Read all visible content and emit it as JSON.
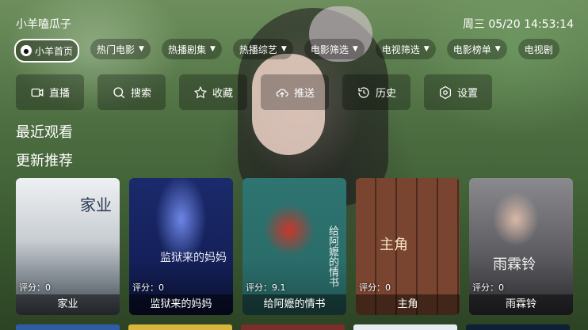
{
  "app": {
    "title": "小羊嗑瓜子"
  },
  "clock": {
    "text": "周三 05/20 14:53:14"
  },
  "menu": [
    {
      "label": "小羊首页",
      "active": true,
      "dropdown": false,
      "logo": "sheep-logo"
    },
    {
      "label": "热门电影",
      "dropdown": true
    },
    {
      "label": "热播剧集",
      "dropdown": true
    },
    {
      "label": "热播综艺",
      "dropdown": true
    },
    {
      "label": "电影筛选",
      "dropdown": true
    },
    {
      "label": "电视筛选",
      "dropdown": true
    },
    {
      "label": "电影榜单",
      "dropdown": true
    },
    {
      "label": "电视剧",
      "dropdown": false
    }
  ],
  "actions": [
    {
      "label": "直播",
      "icon": "live-camera-icon"
    },
    {
      "label": "搜索",
      "icon": "search-icon"
    },
    {
      "label": "收藏",
      "icon": "star-icon"
    },
    {
      "label": "推送",
      "icon": "cloud-upload-icon"
    },
    {
      "label": "历史",
      "icon": "history-icon"
    },
    {
      "label": "设置",
      "icon": "settings-icon"
    }
  ],
  "sections": {
    "recent": "最近观看",
    "updates": "更新推荐"
  },
  "cards": [
    {
      "title": "家业",
      "score": "评分：0",
      "poster_text": "家业",
      "colors": [
        "#e9ecef",
        "#8a8f95"
      ]
    },
    {
      "title": "监狱来的妈妈",
      "score": "评分：0",
      "poster_text": "监狱来的妈妈",
      "colors": [
        "#1b2a6b",
        "#0a0f2a"
      ]
    },
    {
      "title": "给阿嬷的情书",
      "score": "评分：9.1",
      "poster_text": "给阿嬷的情书",
      "colors": [
        "#2a6d6a",
        "#b13a2f"
      ]
    },
    {
      "title": "主角",
      "score": "评分：0",
      "poster_text": "主角",
      "colors": [
        "#6a3a28",
        "#3a1c12"
      ]
    },
    {
      "title": "雨霖铃",
      "score": "评分：0",
      "poster_text": "雨霖铃",
      "colors": [
        "#6f6f73",
        "#2a2a2e"
      ]
    }
  ],
  "bottom_strip_colors": [
    "#2f5ca8",
    "#d8b63a",
    "#7b2e2a",
    "#e7ecf3",
    "#0d2136"
  ]
}
